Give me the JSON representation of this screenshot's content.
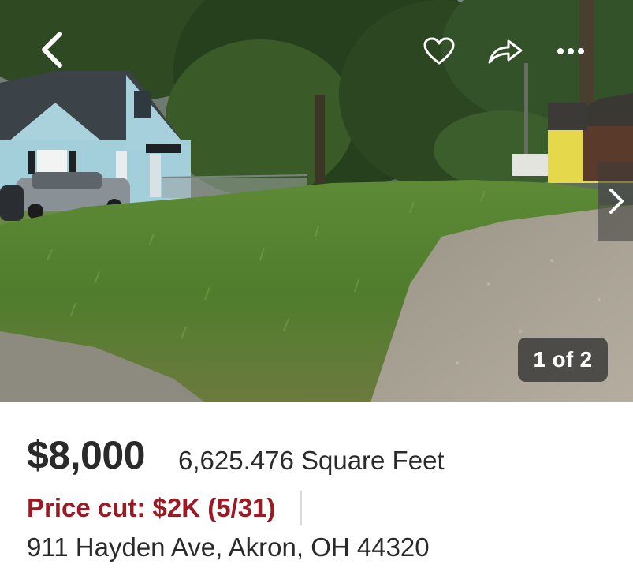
{
  "photo": {
    "counter": "1 of 2",
    "icons": {
      "back": "chevron-left-icon",
      "favorite": "heart-icon",
      "share": "share-arrow-icon",
      "more": "more-dots-icon",
      "next": "chevron-right-icon"
    }
  },
  "listing": {
    "price": "$8,000",
    "size": "6,625.476 Square Feet",
    "price_cut": "Price cut: $2K (5/31)",
    "address": "911 Hayden Ave, Akron, OH 44320"
  },
  "colors": {
    "price_cut": "#9a1b23",
    "text": "#2a2a2a"
  }
}
